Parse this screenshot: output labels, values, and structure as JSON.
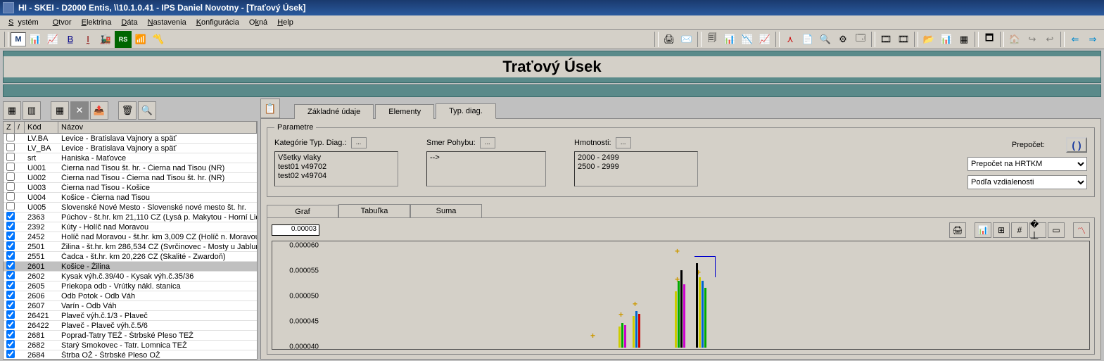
{
  "title": "HI - SKEI - D2000 Entis, \\\\10.1.0.41 - IPS Daniel Novotny - [Traťový Úsek]",
  "menu": {
    "items": [
      "Systém",
      "Otvor",
      "Elektrina",
      "Dáta",
      "Nastavenia",
      "Konfigurácia",
      "Okná",
      "Help"
    ]
  },
  "header": {
    "title": "Traťový Úsek"
  },
  "grid": {
    "headers": {
      "z": "Z",
      "slash": "/",
      "kod": "Kód",
      "nazov": "Názov"
    },
    "rows": [
      {
        "chk": false,
        "kod": "LV.BA",
        "naz": "Levice - Bratislava Vajnory a späť"
      },
      {
        "chk": false,
        "kod": "LV_BA",
        "naz": "Levice - Bratislava Vajnory a späť"
      },
      {
        "chk": false,
        "kod": "srt",
        "naz": "Haniska - Maťovce"
      },
      {
        "chk": false,
        "kod": "U001",
        "naz": "Čierna nad Tisou št. hr. - Čierna nad Tisou (NR)"
      },
      {
        "chk": false,
        "kod": "U002",
        "naz": "Čierna nad Tisou - Čierna nad Tisou št. hr. (NR)"
      },
      {
        "chk": false,
        "kod": "U003",
        "naz": "Čierna nad Tisou - Košice"
      },
      {
        "chk": false,
        "kod": "U004",
        "naz": "Košice - Čierna nad Tisou"
      },
      {
        "chk": false,
        "kod": "U005",
        "naz": "Slovenské Nové Mesto - Slovenské nové mesto št. hr."
      },
      {
        "chk": true,
        "kod": "2363",
        "naz": "Púchov - št.hr. km 21,110 CZ (Lysá p. Makytou - Horní Lid"
      },
      {
        "chk": true,
        "kod": "2392",
        "naz": "Kúty - Holíč nad Moravou"
      },
      {
        "chk": true,
        "kod": "2452",
        "naz": "Holíč nad Moravou - št.hr. km 3,009 CZ (Holíč n. Moravou"
      },
      {
        "chk": true,
        "kod": "2501",
        "naz": "Žilina - št.hr. km 286,534 CZ (Svrčinovec - Mosty u Jablunl"
      },
      {
        "chk": true,
        "kod": "2551",
        "naz": "Čadca - št.hr. km 20,226 CZ (Skalité - Zwardoň)"
      },
      {
        "chk": true,
        "kod": "2601",
        "naz": "Košice - Žilina",
        "sel": true
      },
      {
        "chk": true,
        "kod": "2602",
        "naz": "Kysak výh.č.39/40 - Kysak výh.č.35/36"
      },
      {
        "chk": true,
        "kod": "2605",
        "naz": "Priekopa odb - Vrútky nákl. stanica"
      },
      {
        "chk": true,
        "kod": "2606",
        "naz": "Odb Potok - Odb Váh"
      },
      {
        "chk": true,
        "kod": "2607",
        "naz": "Varín - Odb Váh"
      },
      {
        "chk": true,
        "kod": "26421",
        "naz": "Plaveč výh.č.1/3 - Plaveč"
      },
      {
        "chk": true,
        "kod": "26422",
        "naz": "Plaveč - Plaveč výh.č.5/6"
      },
      {
        "chk": true,
        "kod": "2681",
        "naz": "Poprad-Tatry TEŽ - Štrbské Pleso TEŽ"
      },
      {
        "chk": true,
        "kod": "2682",
        "naz": "Starý Smokovec - Tatr. Lomnica TEŽ"
      },
      {
        "chk": true,
        "kod": "2684",
        "naz": "Štrba OŽ - Štrbské Pleso OŽ"
      }
    ]
  },
  "tabs": {
    "t1": "Základné údaje",
    "t2": "Elementy",
    "t3": "Typ. diag."
  },
  "params": {
    "legend": "Parametre",
    "kategorie_label": "Kategórie Typ. Diag.:",
    "kategorie_items": [
      "Všetky vlaky",
      "test01 v49702",
      "test02 v49704"
    ],
    "smer_label": "Smer Pohybu:",
    "smer_items": [
      "-->"
    ],
    "hmot_label": "Hmotnosti:",
    "hmot_items": [
      "2000 - 2499",
      "2500 - 2999"
    ],
    "recalc_label": "Prepočet:",
    "combo1": "Prepočet na HRTKM",
    "combo2": "Podľa vzdialenosti"
  },
  "subtabs": {
    "s1": "Graf",
    "s2": "Tabuľka",
    "s3": "Suma"
  },
  "chart_data": {
    "type": "bar",
    "current_value": "0.00003",
    "yticks": [
      "0.000060",
      "0.000055",
      "0.000050",
      "0.000045",
      "0.000040"
    ],
    "ylim": [
      4e-05,
      6e-05
    ]
  }
}
